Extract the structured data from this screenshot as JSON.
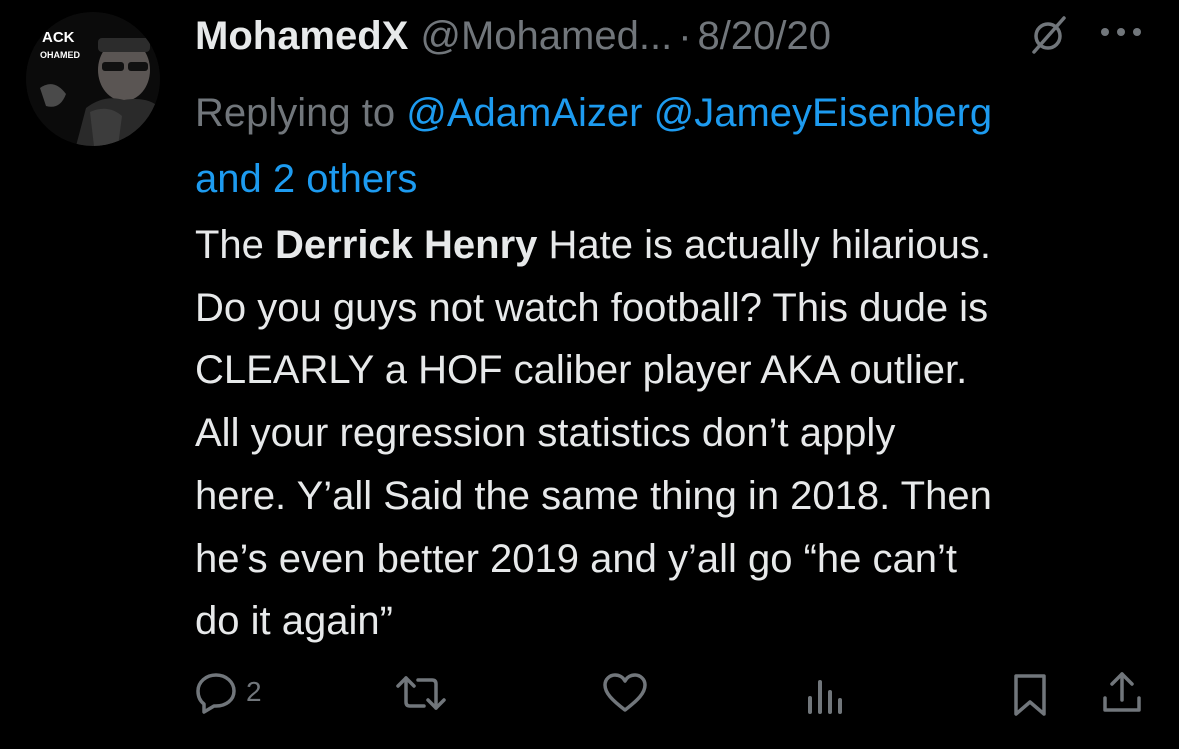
{
  "author": {
    "display_name": "MohamedX",
    "handle": "@Mohamed...",
    "separator": "·",
    "date": "8/20/20",
    "avatar_text_top": "ACK",
    "avatar_text_bottom": "OHAMED"
  },
  "reply": {
    "prefix": "Replying to",
    "mention_1": "@AdamAizer",
    "mention_2": "@JameyEisenberg",
    "others": "and 2 others"
  },
  "tweet": {
    "before_bold": "The ",
    "bold": "Derrick Henry",
    "after_bold": " Hate is actually hilarious.\nDo you guys not watch football? This dude is\nCLEARLY a HOF caliber player AKA outlier.\nAll your regression statistics don’t apply\nhere. Y’all Said the same thing in 2018. Then\nhe’s even better 2019 and y’all go “he can’t\ndo it again”"
  },
  "actions": {
    "reply_count": "2"
  },
  "colors": {
    "background": "#000000",
    "text": "#e7e9ea",
    "muted": "#71767b",
    "link": "#1d9bf0"
  },
  "icons": [
    "grok-icon",
    "more-icon",
    "reply-icon",
    "retweet-icon",
    "like-icon",
    "views-icon",
    "bookmark-icon",
    "share-icon"
  ]
}
